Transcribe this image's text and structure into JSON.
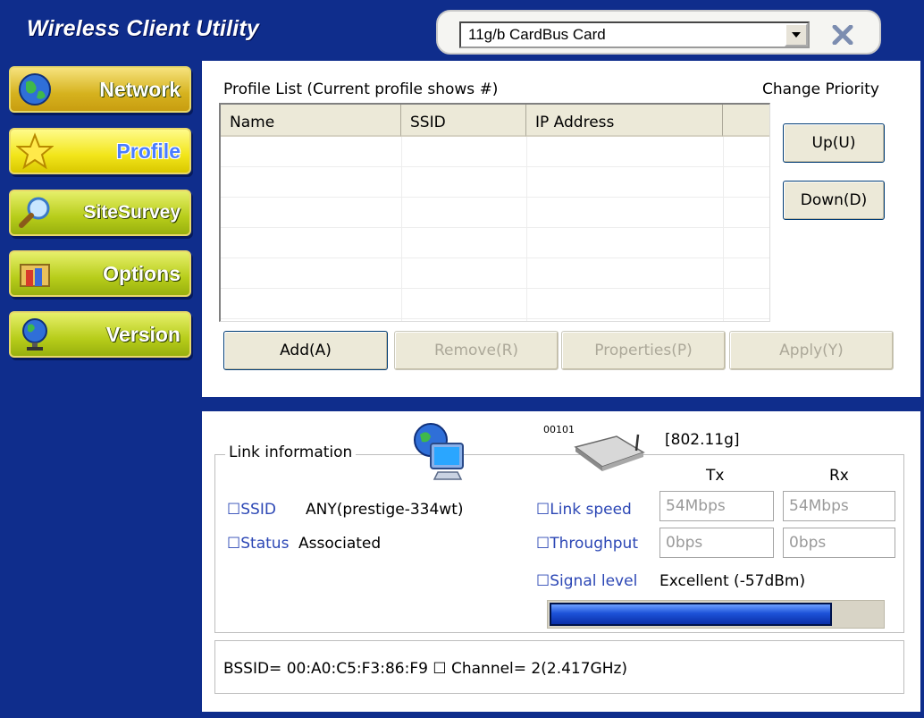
{
  "app": {
    "title": "Wireless Client Utility",
    "adapter_selected": "11g/b CardBus Card"
  },
  "nav": [
    {
      "label": "Network",
      "icon": "globe-icon"
    },
    {
      "label": "Profile",
      "icon": "star-icon"
    },
    {
      "label": "SiteSurvey",
      "icon": "magnifier-icon"
    },
    {
      "label": "Options",
      "icon": "folder-icon"
    },
    {
      "label": "Version",
      "icon": "globe-stand-icon"
    }
  ],
  "profile": {
    "list_caption": "Profile List (Current profile shows #)",
    "change_priority": "Change Priority",
    "columns": [
      "Name",
      "SSID",
      "IP Address",
      ""
    ],
    "up_label": "Up(U)",
    "down_label": "Down(D)",
    "add_label": "Add(A)",
    "remove_label": "Remove(R)",
    "properties_label": "Properties(P)",
    "apply_label": "Apply(Y)"
  },
  "link": {
    "legend": "Link information",
    "ssid_label": "SSID",
    "ssid_value": "ANY(prestige-334wt)",
    "status_label": "Status",
    "status_value": "Associated",
    "binary_label": "00101",
    "standard": "[802.11g]",
    "tx_header": "Tx",
    "rx_header": "Rx",
    "link_speed_label": "Link speed",
    "link_speed_tx": "54Mbps",
    "link_speed_rx": "54Mbps",
    "throughput_label": "Throughput",
    "throughput_tx": "0bps",
    "throughput_rx": "0bps",
    "signal_label": "Signal level",
    "signal_value": "Excellent (-57dBm)",
    "signal_fraction": 0.85,
    "bssid_label": "BSSID= 00:A0:C5:F3:86:F9",
    "channel_label": "Channel= 2(2.417GHz)"
  },
  "colors": {
    "background": "#0f2d8c",
    "accent_label": "#2c47b5",
    "signal_fill": "#1d52d9"
  }
}
